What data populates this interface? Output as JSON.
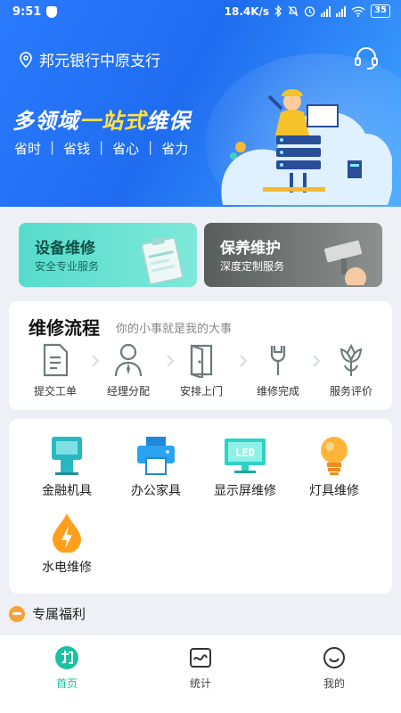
{
  "status_bar": {
    "time": "9:51",
    "network_speed": "18.4K/s",
    "battery": "35",
    "icons": [
      "shield-icon",
      "bluetooth-icon",
      "mute-icon",
      "alarm-icon",
      "signal-icon",
      "signal-icon",
      "wifi-icon",
      "battery-icon"
    ]
  },
  "header": {
    "location": "邦元银行中原支行",
    "location_icon": "location-pin-icon",
    "support_icon": "headset-icon"
  },
  "banner": {
    "slogan_part1": "多领域",
    "slogan_highlight": "一站式",
    "slogan_part2": "维保",
    "tags": [
      "省时",
      "省钱",
      "省心",
      "省力"
    ],
    "separator": "|"
  },
  "services": [
    {
      "title": "设备维修",
      "subtitle": "安全专业服务"
    },
    {
      "title": "保养维护",
      "subtitle": "深度定制服务"
    }
  ],
  "process": {
    "title": "维修流程",
    "subtitle": "你的小事就是我的大事",
    "steps": [
      {
        "label": "提交工单",
        "icon": "document-icon"
      },
      {
        "label": "经理分配",
        "icon": "manager-icon"
      },
      {
        "label": "安排上门",
        "icon": "door-icon"
      },
      {
        "label": "维修完成",
        "icon": "wrench-icon"
      },
      {
        "label": "服务评价",
        "icon": "flower-icon"
      }
    ]
  },
  "categories": [
    {
      "label": "金融机具",
      "icon": "atm-icon"
    },
    {
      "label": "办公家具",
      "icon": "printer-icon"
    },
    {
      "label": "显示屏维修",
      "icon": "led-display-icon"
    },
    {
      "label": "灯具维修",
      "icon": "bulb-icon"
    },
    {
      "label": "水电维修",
      "icon": "water-electric-icon"
    }
  ],
  "benefits": {
    "label": "专属福利"
  },
  "bottom_nav": [
    {
      "label": "首页",
      "icon": "home-logo-icon",
      "active": true
    },
    {
      "label": "统计",
      "icon": "chart-icon",
      "active": false
    },
    {
      "label": "我的",
      "icon": "profile-smile-icon",
      "active": false
    }
  ],
  "colors": {
    "brand_blue": "#1f6cf0",
    "accent_teal": "#1cc0a3",
    "highlight_yellow": "#ffe04a"
  }
}
